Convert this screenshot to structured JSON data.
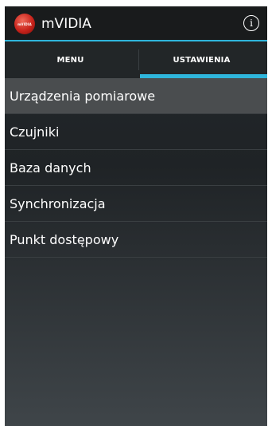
{
  "actionbar": {
    "title": "mVIDIA",
    "logo_text": "mVIDIA",
    "accent_color": "#2fb6dc",
    "info_icon": "info-icon"
  },
  "tabs": [
    {
      "label": "MENU",
      "selected": false
    },
    {
      "label": "USTAWIENIA",
      "selected": true
    }
  ],
  "settings_list": [
    {
      "label": "Urządzenia pomiarowe",
      "selected": true
    },
    {
      "label": "Czujniki",
      "selected": false
    },
    {
      "label": "Baza danych",
      "selected": false
    },
    {
      "label": "Synchronizacja",
      "selected": false
    },
    {
      "label": "Punkt dostępowy",
      "selected": false
    }
  ]
}
